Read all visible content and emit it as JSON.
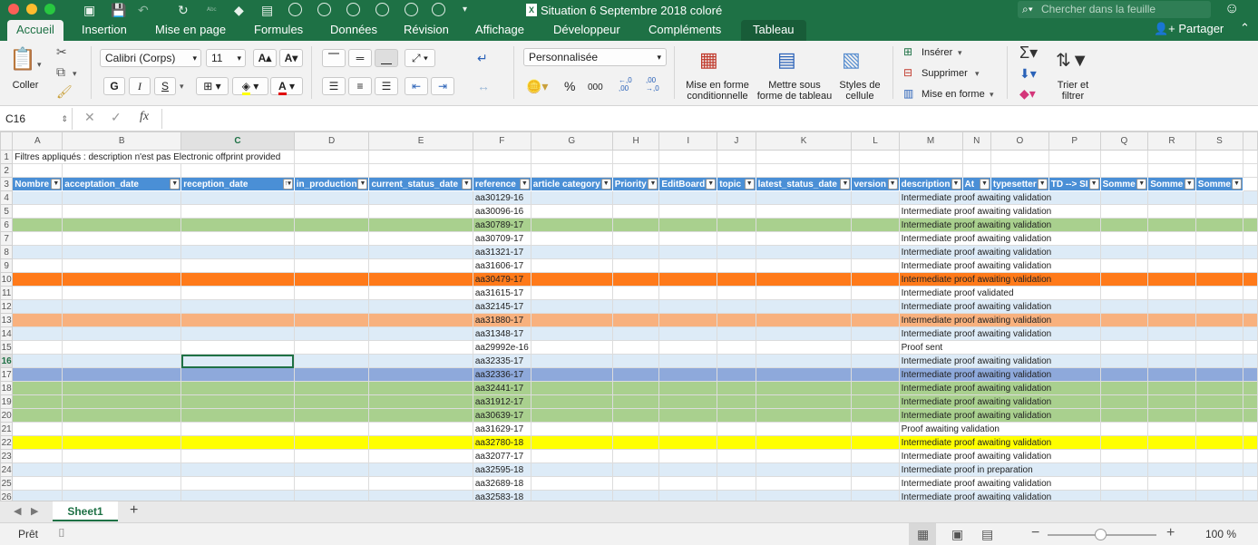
{
  "window": {
    "title": "Situation 6 Septembre 2018 coloré",
    "search_placeholder": "Chercher dans la feuille"
  },
  "ribbon_tabs": [
    "Accueil",
    "Insertion",
    "Mise en page",
    "Formules",
    "Données",
    "Révision",
    "Affichage",
    "Développeur",
    "Compléments",
    "Tableau"
  ],
  "active_tab": "Accueil",
  "share_label": "Partager",
  "ribbon": {
    "paste_label": "Coller",
    "font_name": "Calibri (Corps)",
    "font_size": "11",
    "bold": "G",
    "italic": "I",
    "underline": "S",
    "number_format": "Personnalisée",
    "percent": "%",
    "thousands": "000",
    "dec_increase": "←,0 ,00",
    "dec_decrease": ",00 →,0",
    "conditional_format": "Mise en forme conditionnelle",
    "format_as_table": "Mettre sous forme de tableau",
    "cell_styles": "Styles de cellule",
    "insert": "Insérer",
    "delete": "Supprimer",
    "format": "Mise en forme",
    "sort_filter": "Trier et filtrer"
  },
  "formula_bar": {
    "name_box": "C16",
    "fx": "fx",
    "content": ""
  },
  "columns": [
    "A",
    "B",
    "C",
    "D",
    "E",
    "F",
    "G",
    "H",
    "I",
    "J",
    "K",
    "L",
    "M",
    "N",
    "O",
    "P",
    "Q",
    "R",
    "S"
  ],
  "filter_note": "Filtres appliqués :  description n'est pas Electronic offprint provided",
  "headers": [
    "Nombre",
    "acceptation_date",
    "reception_date",
    "in_production",
    "current_status_date",
    "reference",
    "article category",
    "Priority",
    "EditBoard",
    "topic",
    "latest_status_date",
    "version",
    "description",
    "At",
    "typesetter",
    "TD --> SI",
    "Somme",
    "Somme",
    "Somme"
  ],
  "rows": [
    {
      "num": "4",
      "color": "lightblue",
      "ref": "aa30129-16",
      "desc": "Intermediate proof awaiting validation"
    },
    {
      "num": "5",
      "color": "none",
      "ref": "aa30096-16",
      "desc": "Intermediate proof awaiting validation"
    },
    {
      "num": "6",
      "color": "green",
      "ref": "aa30789-17",
      "desc": "Intermediate proof awaiting validation"
    },
    {
      "num": "7",
      "color": "none",
      "ref": "aa30709-17",
      "desc": "Intermediate proof awaiting validation"
    },
    {
      "num": "8",
      "color": "lightblue",
      "ref": "aa31321-17",
      "desc": "Intermediate proof awaiting validation"
    },
    {
      "num": "9",
      "color": "none",
      "ref": "aa31606-17",
      "desc": "Intermediate proof awaiting validation"
    },
    {
      "num": "10",
      "color": "orange",
      "ref": "aa30479-17",
      "desc": "Intermediate proof awaiting validation"
    },
    {
      "num": "11",
      "color": "none",
      "ref": "aa31615-17",
      "desc": "Intermediate proof validated"
    },
    {
      "num": "12",
      "color": "lightblue",
      "ref": "aa32145-17",
      "desc": "Intermediate proof awaiting validation"
    },
    {
      "num": "13",
      "color": "peach",
      "ref": "aa31880-17",
      "desc": "Intermediate proof awaiting validation"
    },
    {
      "num": "14",
      "color": "lightblue",
      "ref": "aa31348-17",
      "desc": "Intermediate proof awaiting validation"
    },
    {
      "num": "15",
      "color": "none",
      "ref": "aa29992e-16",
      "desc": "Proof sent"
    },
    {
      "num": "16",
      "color": "lightblue",
      "ref": "aa32335-17",
      "desc": "Intermediate proof awaiting validation"
    },
    {
      "num": "17",
      "color": "blue",
      "ref": "aa32336-17",
      "desc": "Intermediate proof awaiting validation"
    },
    {
      "num": "18",
      "color": "green",
      "ref": "aa32441-17",
      "desc": "Intermediate proof awaiting validation"
    },
    {
      "num": "19",
      "color": "green",
      "ref": "aa31912-17",
      "desc": "Intermediate proof awaiting validation"
    },
    {
      "num": "20",
      "color": "green",
      "ref": "aa30639-17",
      "desc": "Intermediate proof awaiting validation"
    },
    {
      "num": "21",
      "color": "none",
      "ref": "aa31629-17",
      "desc": "Proof awaiting validation"
    },
    {
      "num": "22",
      "color": "yellow",
      "ref": "aa32780-18",
      "desc": "Intermediate proof awaiting validation"
    },
    {
      "num": "23",
      "color": "none",
      "ref": "aa32077-17",
      "desc": "Intermediate proof awaiting validation"
    },
    {
      "num": "24",
      "color": "lightblue",
      "ref": "aa32595-18",
      "desc": "Intermediate proof in preparation"
    },
    {
      "num": "25",
      "color": "none",
      "ref": "aa32689-18",
      "desc": "Intermediate proof awaiting validation"
    },
    {
      "num": "26",
      "color": "lightblue",
      "ref": "aa32583-18",
      "desc": "Intermediate proof awaiting validation"
    }
  ],
  "sheet_tab": "Sheet1",
  "status": {
    "ready": "Prêt",
    "zoom": "100 %",
    "zoom_level_percent": 100
  },
  "colors": {
    "brand_green": "#1e7145",
    "header_blue": "#4a8fd6",
    "row_lightblue": "#ddebf7",
    "row_green": "#a9d08e",
    "row_orange": "#ff7a1a",
    "row_peach": "#f8b17e",
    "row_blue": "#8ea9db",
    "row_yellow": "#ffff00"
  }
}
